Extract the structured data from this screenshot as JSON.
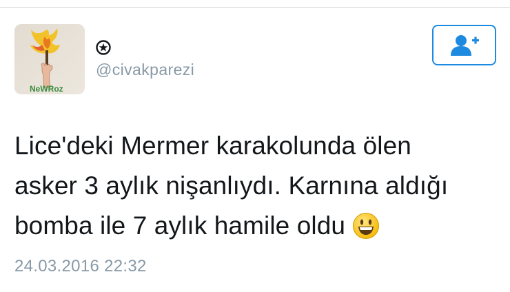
{
  "tweet": {
    "author": {
      "display_icon": "star-circle-icon",
      "handle": "@civakparezi",
      "avatar_caption": "NeWRoz"
    },
    "follow_button": {
      "icon": "add-user-icon",
      "color": "#1d8ae0"
    },
    "text_lines": [
      "Lice'deki Mermer karakolunda ölen",
      "asker 3 aylık nişanlıydı. Karnına aldığı",
      "bomba ile 7 aylık hamile oldu"
    ],
    "emoji": "grinning-face-emoji",
    "timestamp": "24.03.2016 22:32"
  }
}
